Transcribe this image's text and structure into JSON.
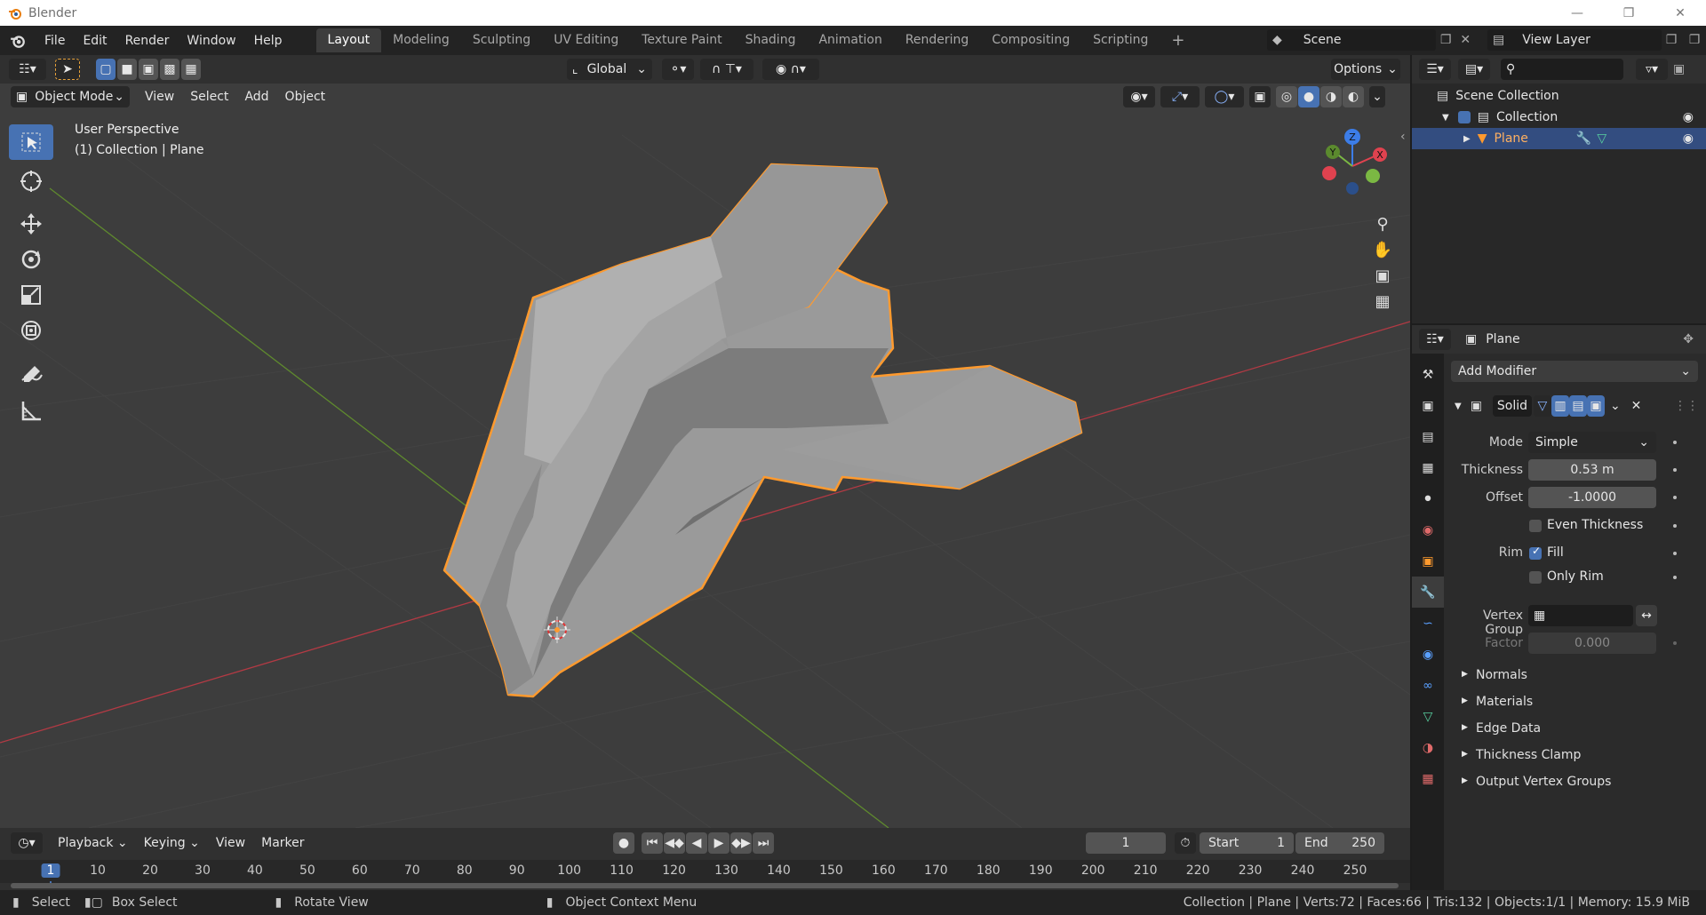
{
  "app": {
    "title": "Blender"
  },
  "menus": [
    "File",
    "Edit",
    "Render",
    "Window",
    "Help"
  ],
  "workspaces": [
    "Layout",
    "Modeling",
    "Sculpting",
    "UV Editing",
    "Texture Paint",
    "Shading",
    "Animation",
    "Rendering",
    "Compositing",
    "Scripting"
  ],
  "scene": {
    "name": "Scene",
    "view_layer": "View Layer"
  },
  "viewport": {
    "transform_orientation": "Global",
    "options_label": "Options",
    "mode": "Object Mode",
    "menus": [
      "View",
      "Select",
      "Add",
      "Object"
    ],
    "info_line1": "User Perspective",
    "info_line2": "(1) Collection | Plane",
    "gizmo": {
      "x": "X",
      "y": "Y",
      "z": "Z"
    }
  },
  "timeline": {
    "menus": [
      "Playback",
      "Keying",
      "View",
      "Marker"
    ],
    "current_frame": "1",
    "start_label": "Start",
    "start": "1",
    "end_label": "End",
    "end": "250",
    "ticks": [
      "1",
      "10",
      "20",
      "30",
      "40",
      "50",
      "60",
      "70",
      "80",
      "90",
      "100",
      "110",
      "120",
      "130",
      "140",
      "150",
      "160",
      "170",
      "180",
      "190",
      "200",
      "210",
      "220",
      "230",
      "240",
      "250"
    ]
  },
  "statusbar": {
    "select": "Select",
    "box_select": "Box Select",
    "rotate_view": "Rotate View",
    "context_menu": "Object Context Menu",
    "stats": "Collection | Plane | Verts:72 | Faces:66 | Tris:132 | Objects:1/1 | Memory: 15.9 MiB"
  },
  "outliner": {
    "scene_collection": "Scene Collection",
    "collection": "Collection",
    "object": "Plane"
  },
  "properties": {
    "object_name": "Plane",
    "add_modifier": "Add Modifier",
    "modifier_name": "Solid",
    "mode_label": "Mode",
    "mode_value": "Simple",
    "thickness_label": "Thickness",
    "thickness_value": "0.53 m",
    "offset_label": "Offset",
    "offset_value": "-1.0000",
    "even_thickness": "Even Thickness",
    "rim_label": "Rim",
    "fill": "Fill",
    "only_rim": "Only Rim",
    "vertex_group_label": "Vertex Group",
    "factor_label": "Factor",
    "factor_value": "0.000",
    "subpanels": [
      "Normals",
      "Materials",
      "Edge Data",
      "Thickness Clamp",
      "Output Vertex Groups"
    ]
  },
  "colors": {
    "accent": "#4772b3",
    "selection": "#ff9a2e",
    "x_axis": "#e0424f",
    "y_axis": "#7bb843",
    "z_axis": "#3c7de8"
  }
}
